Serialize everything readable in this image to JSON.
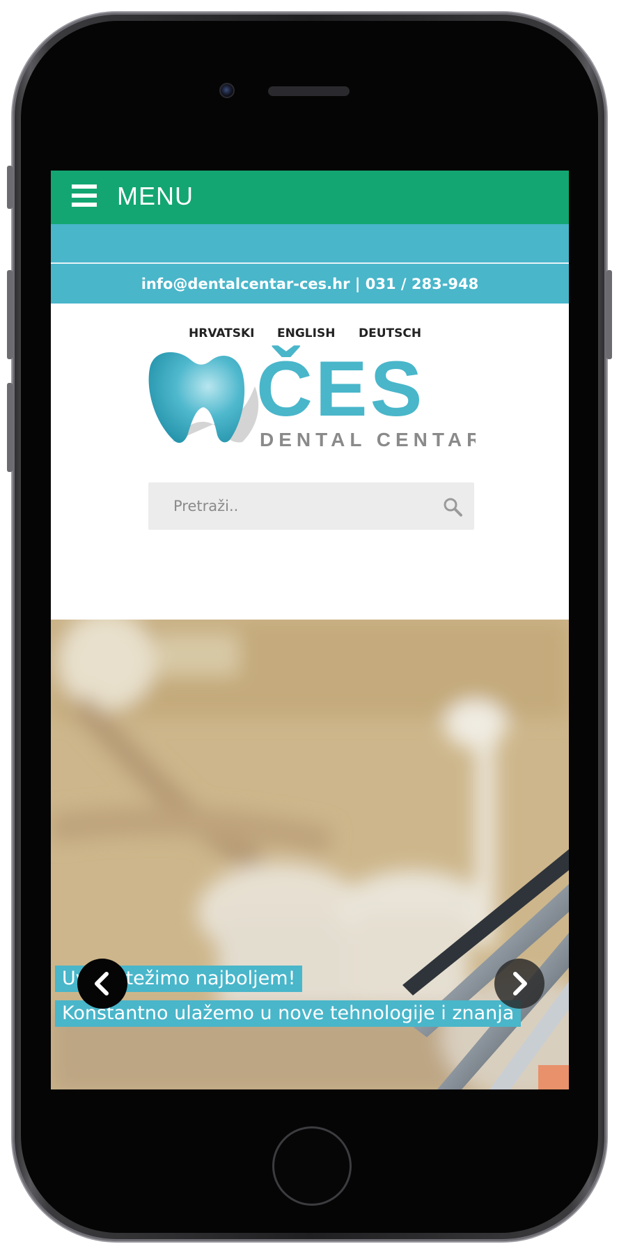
{
  "header": {
    "menu_label": "MENU"
  },
  "contact": {
    "text": "info@dentalcentar-ces.hr | 031 / 283-948"
  },
  "languages": [
    "HRVATSKI",
    "ENGLISH",
    "DEUTSCH"
  ],
  "logo": {
    "name": "ČES",
    "subtitle": "DENTAL CENTAR"
  },
  "search": {
    "placeholder": "Pretraži.."
  },
  "slider": {
    "caption_title": "Uvijek težimo najboljem!",
    "caption_text": "Konstantno ulažemo u nove tehnologije i znanja"
  },
  "colors": {
    "menu_bar": "#13a672",
    "accent_blue": "#49b6ca",
    "logo_teal": "#49b6ca",
    "logo_gray": "#8a8a8a"
  },
  "icons": {
    "menu": "hamburger-icon",
    "search": "magnifier-icon",
    "prev": "chevron-left-icon",
    "next": "chevron-right-icon"
  }
}
